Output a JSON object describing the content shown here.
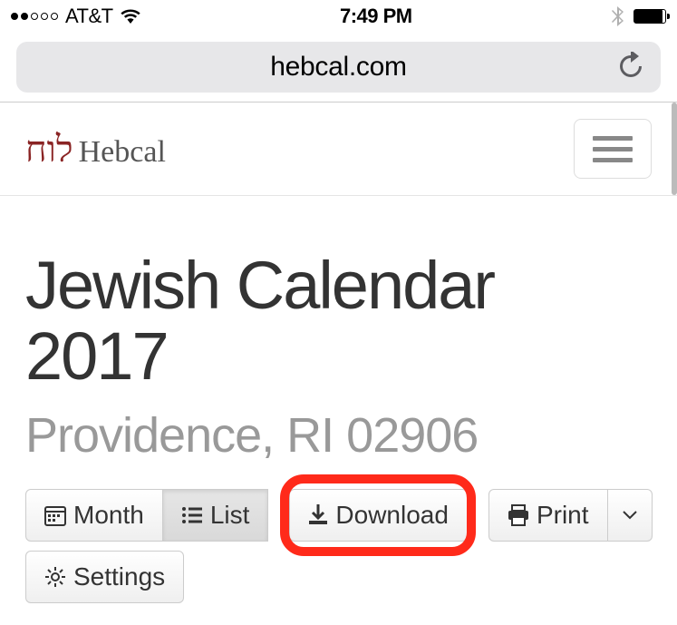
{
  "status": {
    "carrier": "AT&T",
    "time": "7:49 PM"
  },
  "browser": {
    "url_display": "hebcal.com"
  },
  "header": {
    "brand_hebrew": "לוח",
    "brand_name": "Hebcal"
  },
  "page": {
    "title": "Jewish Calendar 2017",
    "subtitle": "Providence, RI 02906"
  },
  "toolbar": {
    "month": "Month",
    "list": "List",
    "download": "Download",
    "print": "Print",
    "settings": "Settings"
  }
}
